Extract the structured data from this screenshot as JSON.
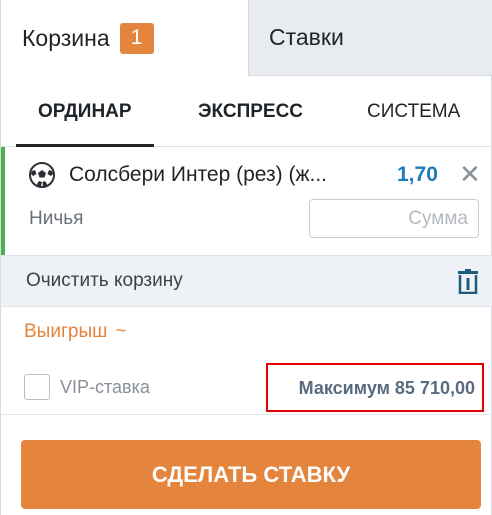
{
  "tabs": {
    "cart_label": "Корзина",
    "cart_count": "1",
    "bets_label": "Ставки"
  },
  "bet_types": {
    "single": "ОРДИНАР",
    "express": "ЭКСПРЕСС",
    "system": "СИСТЕМА"
  },
  "bet": {
    "match": "Солсбери Интер (рез) (ж...",
    "odds": "1,70",
    "outcome": "Ничья",
    "amount_placeholder": "Сумма",
    "sport_icon": "soccer-ball-icon"
  },
  "cart": {
    "clear_label": "Очистить корзину"
  },
  "win": {
    "label": "Выигрыш",
    "value": "~"
  },
  "vip": {
    "label": "VIP-ставка"
  },
  "max": {
    "text": "Максимум 85 710,00"
  },
  "submit": {
    "label": "СДЕЛАТЬ СТАВКУ"
  },
  "colors": {
    "accent": "#e4843d",
    "odds": "#1e7ab8",
    "highlight_border": "#e00000",
    "selection_bar": "#4caf50"
  }
}
